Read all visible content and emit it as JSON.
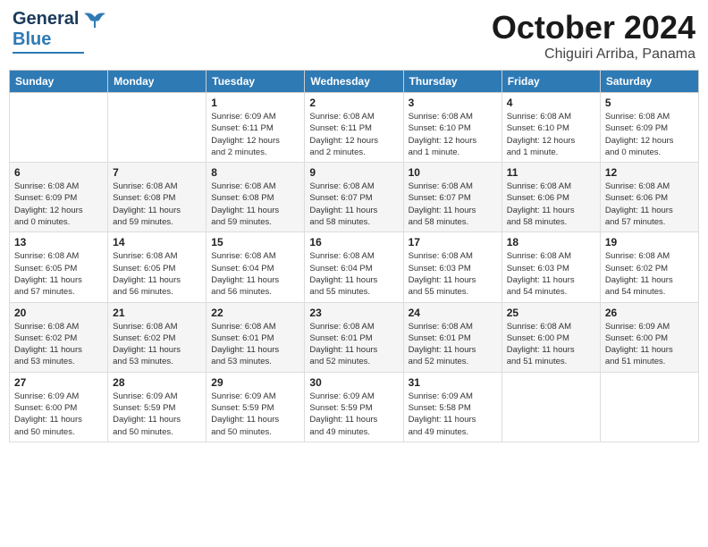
{
  "header": {
    "logo_general": "General",
    "logo_blue": "Blue",
    "month_title": "October 2024",
    "subtitle": "Chiguiri Arriba, Panama"
  },
  "days_of_week": [
    "Sunday",
    "Monday",
    "Tuesday",
    "Wednesday",
    "Thursday",
    "Friday",
    "Saturday"
  ],
  "weeks": [
    [
      {
        "day": "",
        "info": ""
      },
      {
        "day": "",
        "info": ""
      },
      {
        "day": "1",
        "info": "Sunrise: 6:09 AM\nSunset: 6:11 PM\nDaylight: 12 hours\nand 2 minutes."
      },
      {
        "day": "2",
        "info": "Sunrise: 6:08 AM\nSunset: 6:11 PM\nDaylight: 12 hours\nand 2 minutes."
      },
      {
        "day": "3",
        "info": "Sunrise: 6:08 AM\nSunset: 6:10 PM\nDaylight: 12 hours\nand 1 minute."
      },
      {
        "day": "4",
        "info": "Sunrise: 6:08 AM\nSunset: 6:10 PM\nDaylight: 12 hours\nand 1 minute."
      },
      {
        "day": "5",
        "info": "Sunrise: 6:08 AM\nSunset: 6:09 PM\nDaylight: 12 hours\nand 0 minutes."
      }
    ],
    [
      {
        "day": "6",
        "info": "Sunrise: 6:08 AM\nSunset: 6:09 PM\nDaylight: 12 hours\nand 0 minutes."
      },
      {
        "day": "7",
        "info": "Sunrise: 6:08 AM\nSunset: 6:08 PM\nDaylight: 11 hours\nand 59 minutes."
      },
      {
        "day": "8",
        "info": "Sunrise: 6:08 AM\nSunset: 6:08 PM\nDaylight: 11 hours\nand 59 minutes."
      },
      {
        "day": "9",
        "info": "Sunrise: 6:08 AM\nSunset: 6:07 PM\nDaylight: 11 hours\nand 58 minutes."
      },
      {
        "day": "10",
        "info": "Sunrise: 6:08 AM\nSunset: 6:07 PM\nDaylight: 11 hours\nand 58 minutes."
      },
      {
        "day": "11",
        "info": "Sunrise: 6:08 AM\nSunset: 6:06 PM\nDaylight: 11 hours\nand 58 minutes."
      },
      {
        "day": "12",
        "info": "Sunrise: 6:08 AM\nSunset: 6:06 PM\nDaylight: 11 hours\nand 57 minutes."
      }
    ],
    [
      {
        "day": "13",
        "info": "Sunrise: 6:08 AM\nSunset: 6:05 PM\nDaylight: 11 hours\nand 57 minutes."
      },
      {
        "day": "14",
        "info": "Sunrise: 6:08 AM\nSunset: 6:05 PM\nDaylight: 11 hours\nand 56 minutes."
      },
      {
        "day": "15",
        "info": "Sunrise: 6:08 AM\nSunset: 6:04 PM\nDaylight: 11 hours\nand 56 minutes."
      },
      {
        "day": "16",
        "info": "Sunrise: 6:08 AM\nSunset: 6:04 PM\nDaylight: 11 hours\nand 55 minutes."
      },
      {
        "day": "17",
        "info": "Sunrise: 6:08 AM\nSunset: 6:03 PM\nDaylight: 11 hours\nand 55 minutes."
      },
      {
        "day": "18",
        "info": "Sunrise: 6:08 AM\nSunset: 6:03 PM\nDaylight: 11 hours\nand 54 minutes."
      },
      {
        "day": "19",
        "info": "Sunrise: 6:08 AM\nSunset: 6:02 PM\nDaylight: 11 hours\nand 54 minutes."
      }
    ],
    [
      {
        "day": "20",
        "info": "Sunrise: 6:08 AM\nSunset: 6:02 PM\nDaylight: 11 hours\nand 53 minutes."
      },
      {
        "day": "21",
        "info": "Sunrise: 6:08 AM\nSunset: 6:02 PM\nDaylight: 11 hours\nand 53 minutes."
      },
      {
        "day": "22",
        "info": "Sunrise: 6:08 AM\nSunset: 6:01 PM\nDaylight: 11 hours\nand 53 minutes."
      },
      {
        "day": "23",
        "info": "Sunrise: 6:08 AM\nSunset: 6:01 PM\nDaylight: 11 hours\nand 52 minutes."
      },
      {
        "day": "24",
        "info": "Sunrise: 6:08 AM\nSunset: 6:01 PM\nDaylight: 11 hours\nand 52 minutes."
      },
      {
        "day": "25",
        "info": "Sunrise: 6:08 AM\nSunset: 6:00 PM\nDaylight: 11 hours\nand 51 minutes."
      },
      {
        "day": "26",
        "info": "Sunrise: 6:09 AM\nSunset: 6:00 PM\nDaylight: 11 hours\nand 51 minutes."
      }
    ],
    [
      {
        "day": "27",
        "info": "Sunrise: 6:09 AM\nSunset: 6:00 PM\nDaylight: 11 hours\nand 50 minutes."
      },
      {
        "day": "28",
        "info": "Sunrise: 6:09 AM\nSunset: 5:59 PM\nDaylight: 11 hours\nand 50 minutes."
      },
      {
        "day": "29",
        "info": "Sunrise: 6:09 AM\nSunset: 5:59 PM\nDaylight: 11 hours\nand 50 minutes."
      },
      {
        "day": "30",
        "info": "Sunrise: 6:09 AM\nSunset: 5:59 PM\nDaylight: 11 hours\nand 49 minutes."
      },
      {
        "day": "31",
        "info": "Sunrise: 6:09 AM\nSunset: 5:58 PM\nDaylight: 11 hours\nand 49 minutes."
      },
      {
        "day": "",
        "info": ""
      },
      {
        "day": "",
        "info": ""
      }
    ]
  ]
}
